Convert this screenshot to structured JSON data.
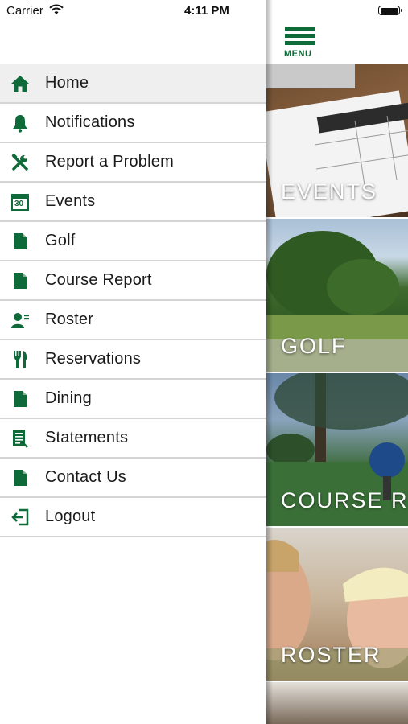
{
  "status_bar": {
    "carrier": "Carrier",
    "time": "4:11 PM"
  },
  "drawer": {
    "items": [
      {
        "label": "Home",
        "icon": "home-icon",
        "active": true
      },
      {
        "label": "Notifications",
        "icon": "bell-icon"
      },
      {
        "label": "Report a Problem",
        "icon": "tools-icon"
      },
      {
        "label": "Events",
        "icon": "calendar-icon",
        "calendar_day": "30"
      },
      {
        "label": "Golf",
        "icon": "document-icon"
      },
      {
        "label": "Course Report",
        "icon": "document-icon"
      },
      {
        "label": "Roster",
        "icon": "roster-icon"
      },
      {
        "label": "Reservations",
        "icon": "fork-knife-icon"
      },
      {
        "label": "Dining",
        "icon": "document-icon"
      },
      {
        "label": "Statements",
        "icon": "statement-icon"
      },
      {
        "label": "Contact Us",
        "icon": "document-icon"
      },
      {
        "label": "Logout",
        "icon": "logout-icon"
      }
    ]
  },
  "header": {
    "menu_label": "MENU"
  },
  "tiles": [
    {
      "title": "EVENTS"
    },
    {
      "title": "GOLF"
    },
    {
      "title": "COURSE REPORT"
    },
    {
      "title": "ROSTER"
    }
  ],
  "colors": {
    "accent": "#0f6a3a",
    "active_row": "#efefef",
    "divider": "#d5d5d5"
  }
}
